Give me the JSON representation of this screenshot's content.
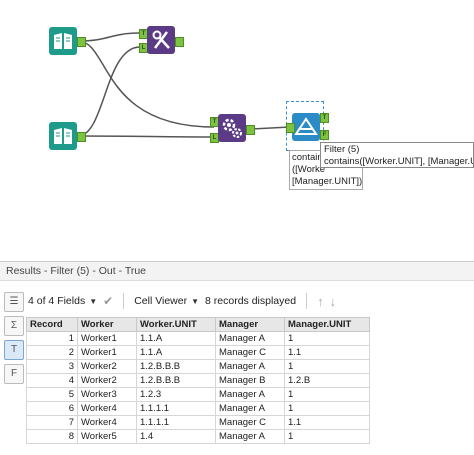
{
  "canvas": {
    "tooltip": {
      "title": "Filter (5)",
      "expression": "contains([Worker.UNIT], [Manager.UNI"
    },
    "annotation": {
      "lines": [
        "contains(",
        "([Worke",
        "[Manager.UNIT])"
      ]
    },
    "anchors": {
      "t": "T",
      "f": "F",
      "j": "J",
      "l": "L",
      "r": "R"
    },
    "colors": {
      "input_tool": "#1e9b8a",
      "join_tool": "#5b3a86",
      "filter_tool": "#2b8bc7",
      "anchor": "#7ec242"
    }
  },
  "results": {
    "title": "Results - Filter (5) - Out - True",
    "toolbar": {
      "fields": "4 of 4 Fields",
      "viewer": "Cell Viewer",
      "records": "8 records displayed"
    },
    "columns": [
      "Record",
      "Worker",
      "Worker.UNIT",
      "Manager",
      "Manager.UNIT"
    ],
    "rows": [
      [
        "1",
        "Worker1",
        "1.1.A",
        "Manager A",
        "1"
      ],
      [
        "2",
        "Worker1",
        "1.1.A",
        "Manager C",
        "1.1"
      ],
      [
        "3",
        "Worker2",
        "1.2.B.B.B",
        "Manager A",
        "1"
      ],
      [
        "4",
        "Worker2",
        "1.2.B.B.B",
        "Manager B",
        "1.2.B"
      ],
      [
        "5",
        "Worker3",
        "1.2.3",
        "Manager A",
        "1"
      ],
      [
        "6",
        "Worker4",
        "1.1.1.1",
        "Manager A",
        "1"
      ],
      [
        "7",
        "Worker4",
        "1.1.1.1",
        "Manager C",
        "1.1"
      ],
      [
        "8",
        "Worker5",
        "1.4",
        "Manager A",
        "1"
      ]
    ]
  }
}
